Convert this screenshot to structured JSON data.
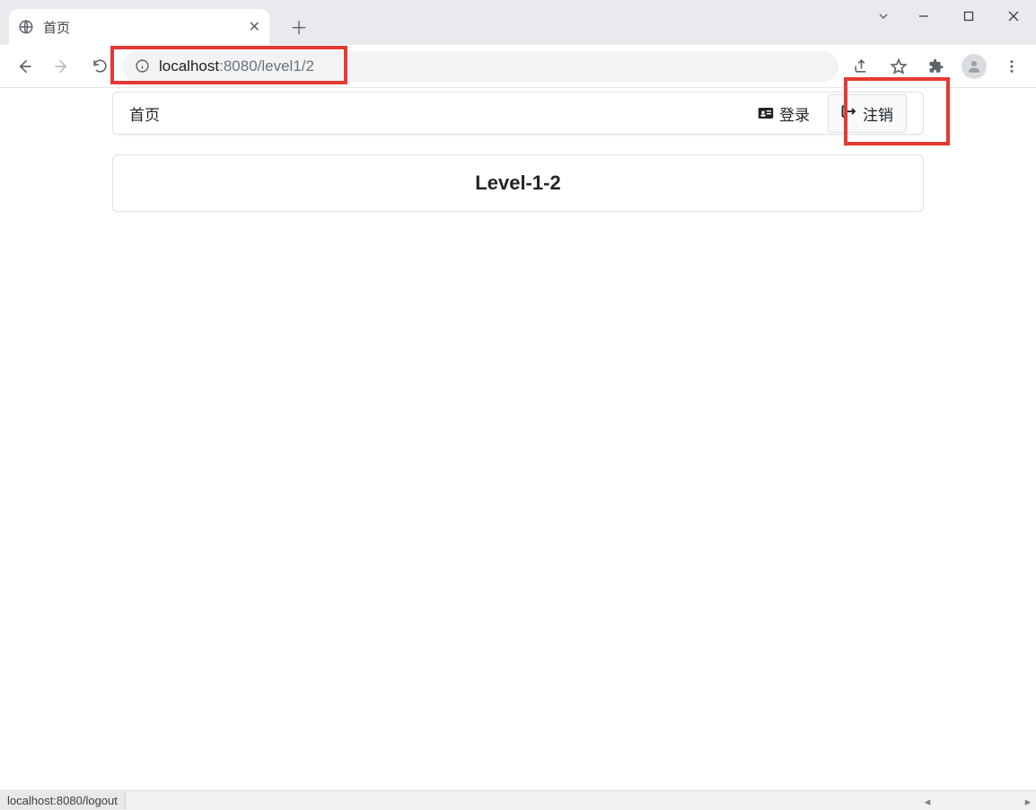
{
  "browser": {
    "tab_title": "首页",
    "url_host": "localhost",
    "url_port_path": ":8080/level1/2",
    "status_url": "localhost:8080/logout"
  },
  "nav": {
    "home_label": "首页",
    "login_label": "登录",
    "logout_label": "注销"
  },
  "content": {
    "heading": "Level-1-2"
  }
}
